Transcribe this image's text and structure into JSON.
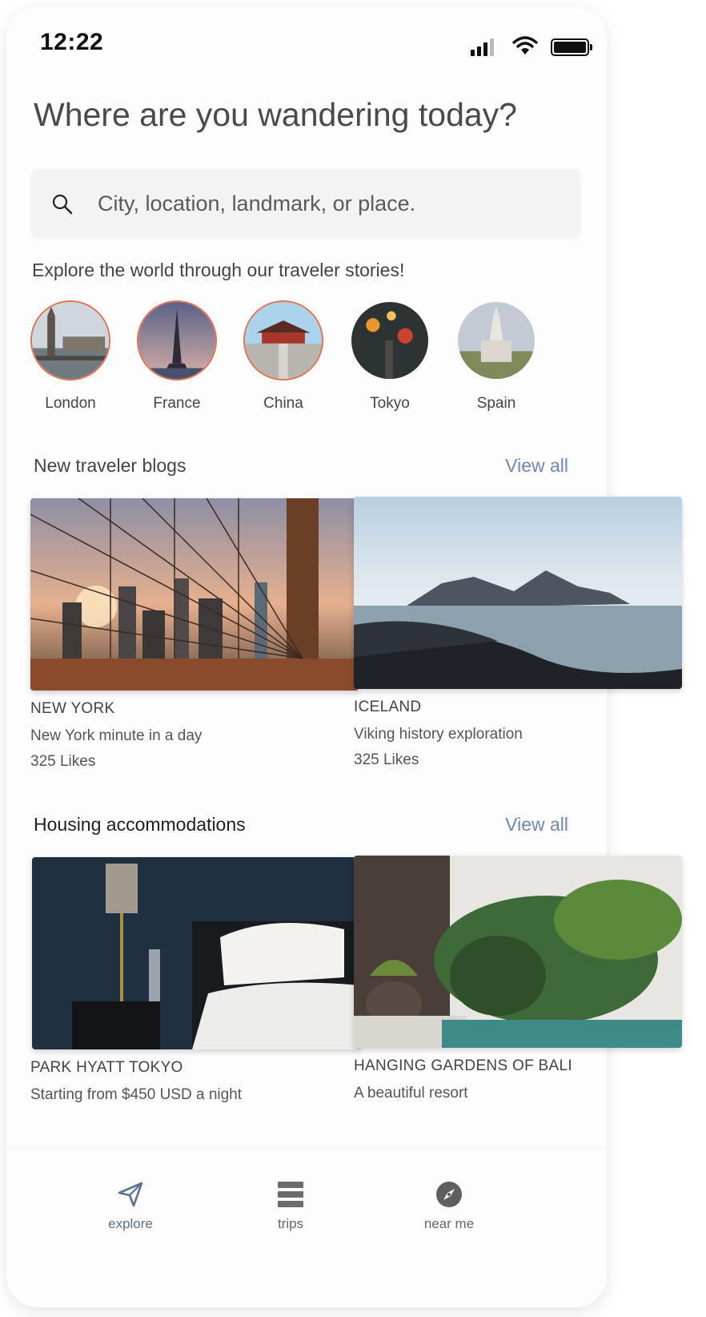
{
  "status_bar": {
    "time": "12:22"
  },
  "headline": "Where are you wandering today?",
  "search": {
    "placeholder": "City, location, landmark, or place.",
    "value": ""
  },
  "stories": {
    "title": "Explore the world through our traveler stories!",
    "items": [
      {
        "label": "London",
        "ring": true
      },
      {
        "label": "France",
        "ring": true
      },
      {
        "label": "China",
        "ring": true
      },
      {
        "label": "Tokyo",
        "ring": false
      },
      {
        "label": "Spain",
        "ring": false
      }
    ]
  },
  "blogs": {
    "title": "New traveler blogs",
    "view_all": "View all",
    "cards": [
      {
        "category": "NEW YORK",
        "subtitle": "New York minute in a day",
        "likes": "325 Likes"
      },
      {
        "category": "ICELAND",
        "subtitle": "Viking history exploration",
        "likes": "325 Likes"
      }
    ]
  },
  "housing": {
    "title": "Housing accommodations",
    "view_all": "View all",
    "cards": [
      {
        "category": "PARK HYATT TOKYO",
        "subtitle": "Starting from $450 USD a night"
      },
      {
        "category": "HANGING GARDENS OF BALI",
        "subtitle": "A beautiful resort"
      }
    ]
  },
  "tabs": [
    {
      "label": "explore",
      "icon": "paper-plane-icon",
      "active": true
    },
    {
      "label": "trips",
      "icon": "list-icon",
      "active": false
    },
    {
      "label": "near me",
      "icon": "compass-icon",
      "active": false
    }
  ],
  "colors": {
    "accent": "#6f87b5",
    "story_ring": "#e27253",
    "active_tab": "#5b6f96"
  }
}
